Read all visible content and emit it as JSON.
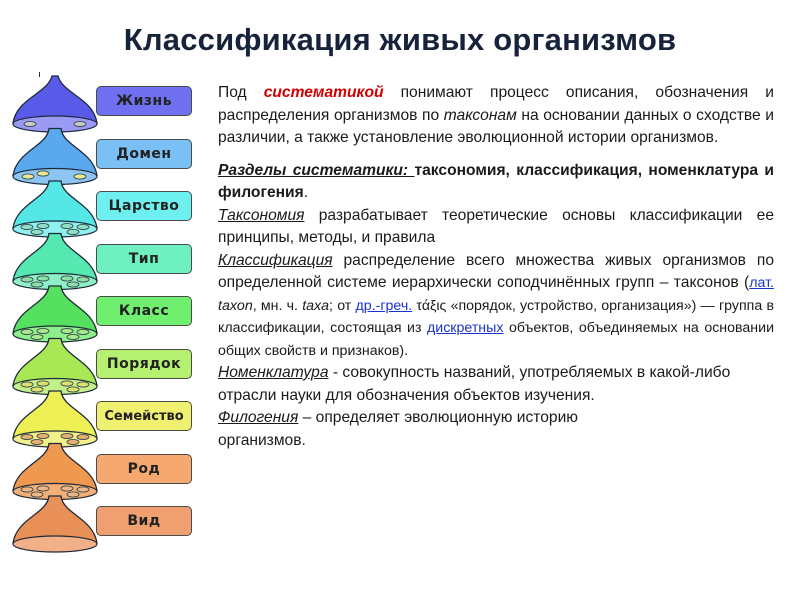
{
  "title": "Классификация живых организмов",
  "ranks": [
    {
      "label": "Жизнь",
      "box_color": "#7070f0",
      "cap_color": "#5a5ae8",
      "base_color": "#9a9af5",
      "dots": "#c8c8c8"
    },
    {
      "label": "Домен",
      "box_color": "#7ac0f5",
      "cap_color": "#5aa8ee",
      "base_color": "#8cc4f2",
      "dots": "#e8e89a"
    },
    {
      "label": "Царство",
      "box_color": "#6ff0f0",
      "cap_color": "#55e6e6",
      "base_color": "#8ff2f0",
      "dots": "#8fe0c8"
    },
    {
      "label": "Тип",
      "box_color": "#6ff0c0",
      "cap_color": "#55e8b0",
      "base_color": "#8ef0c8",
      "dots": "#8fe0a8"
    },
    {
      "label": "Класс",
      "box_color": "#70ee70",
      "cap_color": "#55e060",
      "base_color": "#8ef08a",
      "dots": "#a8e890"
    },
    {
      "label": "Порядок",
      "box_color": "#b6f070",
      "cap_color": "#a8e855",
      "base_color": "#c4f08a",
      "dots": "#e0e070"
    },
    {
      "label": "Семейство",
      "box_color": "#f0f070",
      "cap_color": "#eeee55",
      "base_color": "#f2f08a",
      "dots": "#e8b070"
    },
    {
      "label": "Род",
      "box_color": "#f5a870",
      "cap_color": "#ee9850",
      "base_color": "#f2b078",
      "dots": "#f0b888"
    },
    {
      "label": "Вид",
      "box_color": "#f0a070",
      "cap_color": "#e89058",
      "base_color": "#f2b088",
      "dots": ""
    }
  ],
  "intro": {
    "part1": "Под ",
    "highlight": "систематикой",
    "part2": " понимают процесс описания, обозначения и распределения организмов по ",
    "italic": "таксонам",
    "part3": " на основании данных о сходстве и различии, а также установление эволюционной истории организмов."
  },
  "sections": {
    "heading_term": "Разделы систематики: ",
    "heading_rest": "таксономия, классификация, номенклатура и филогения",
    "heading_end": "."
  },
  "taxonomy": {
    "term": "Таксономия",
    "text": " разрабатывает теоретические основы классификации ее принципы, методы, и правила"
  },
  "classification": {
    "term": "Классификация",
    "text": " распределение всего множества живых организмов по определенной системе иерархически соподчинённых групп – таксонов (",
    "link_lat": "лат.",
    "lat_text": " ",
    "taxon": "taxon",
    "mn": ", мн. ч. ",
    "taxa": "taxa",
    "ot": "; от ",
    "link_greek": "др.-греч.",
    "greek_text": " τάξις «порядок, устройство, организация») — группа в классификации, состоящая из ",
    "link_discrete": "дискретных",
    "tail": " объектов, объединяемых на основании общих свойств и признаков)."
  },
  "nomenclature": {
    "term": "Номенклатура",
    "text": " -  совокупность названий, употребляемых в какой-либо отрасли науки для обозначения объектов изучения."
  },
  "phylogeny": {
    "term": "Филогения",
    "text": " – определяет эволюционную историю организмов."
  }
}
